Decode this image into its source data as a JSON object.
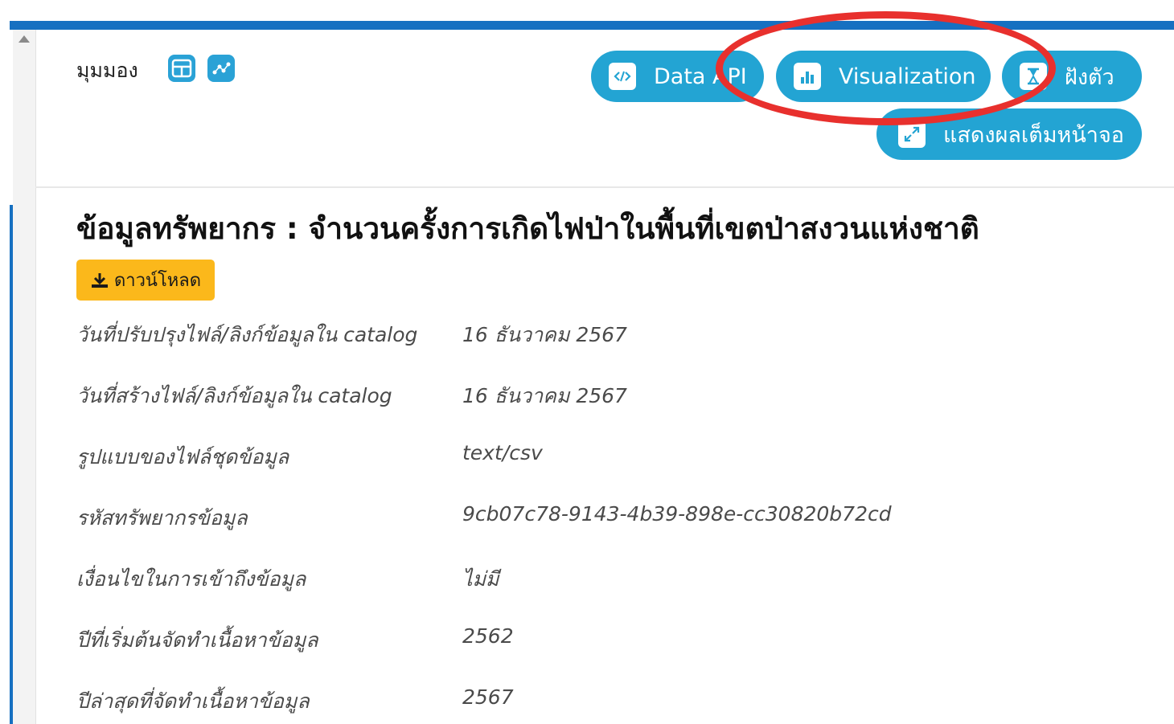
{
  "view": {
    "label": "มุมมอง",
    "icons": [
      "table-icon",
      "chart-icon"
    ]
  },
  "actions": {
    "data_api": "Data API",
    "visualization": "Visualization",
    "embed": "ฝังตัว",
    "fullscreen": "แสดงผลเต็มหน้าจอ"
  },
  "resource": {
    "title": "ข้อมูลทรัพยากร : จำนวนครั้งการเกิดไฟป่าในพื้นที่เขตป่าสงวนแห่งชาติ",
    "download_label": "ดาวน์โหลด"
  },
  "metadata": [
    {
      "key": "วันที่ปรับปรุงไฟล์/ลิงก์ข้อมูลใน catalog",
      "value": "16 ธันวาคม 2567"
    },
    {
      "key": "วันที่สร้างไฟล์/ลิงก์ข้อมูลใน catalog",
      "value": "16 ธันวาคม 2567"
    },
    {
      "key": "รูปแบบของไฟล์ชุดข้อมูล",
      "value": "text/csv"
    },
    {
      "key": "รหัสทรัพยากรข้อมูล",
      "value": "9cb07c78-9143-4b39-898e-cc30820b72cd"
    },
    {
      "key": "เงื่อนไขในการเข้าถึงข้อมูล",
      "value": "ไม่มี"
    },
    {
      "key": "ปีที่เริ่มต้นจัดทำเนื้อหาข้อมูล",
      "value": "2562"
    },
    {
      "key": "ปีล่าสุดที่จัดทำเนื้อหาข้อมูล",
      "value": "2567"
    }
  ],
  "colors": {
    "accent": "#23a4d3",
    "brand_bar": "#1670c1",
    "download": "#fbb81b",
    "annotation": "#e8302d"
  }
}
